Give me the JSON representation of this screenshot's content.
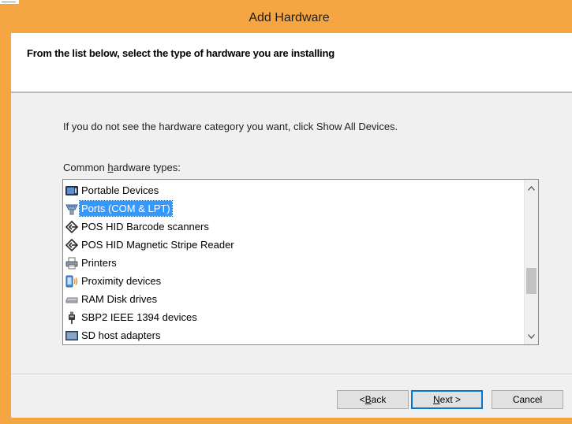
{
  "window": {
    "title": "Add Hardware",
    "accent_color": "#f5a642"
  },
  "header": {
    "heading": "From the list below, select the type of hardware you are installing"
  },
  "body": {
    "hint": "If you do not see the hardware category you want, click Show All Devices.",
    "list_label_prefix": "Common ",
    "list_label_access_key": "h",
    "list_label_suffix": "ardware types:"
  },
  "hardware_list": {
    "items": [
      {
        "label": "Portable Devices",
        "icon": "portable-devices-icon",
        "selected": false
      },
      {
        "label": "Ports (COM & LPT)",
        "icon": "ports-icon",
        "selected": true
      },
      {
        "label": "POS HID Barcode scanners",
        "icon": "pos-hid-icon",
        "selected": false
      },
      {
        "label": "POS HID Magnetic Stripe Reader",
        "icon": "pos-hid-icon",
        "selected": false
      },
      {
        "label": "Printers",
        "icon": "printer-icon",
        "selected": false
      },
      {
        "label": "Proximity devices",
        "icon": "proximity-icon",
        "selected": false
      },
      {
        "label": "RAM Disk drives",
        "icon": "disk-drive-icon",
        "selected": false
      },
      {
        "label": "SBP2 IEEE 1394 devices",
        "icon": "ieee1394-icon",
        "selected": false
      },
      {
        "label": "SD host adapters",
        "icon": "sd-adapter-icon",
        "selected": false
      }
    ],
    "selection_color": "#3399ff"
  },
  "buttons": {
    "back_prefix": "< ",
    "back_key": "B",
    "back_suffix": "ack",
    "next_key": "N",
    "next_suffix": "ext >",
    "cancel": "Cancel"
  }
}
